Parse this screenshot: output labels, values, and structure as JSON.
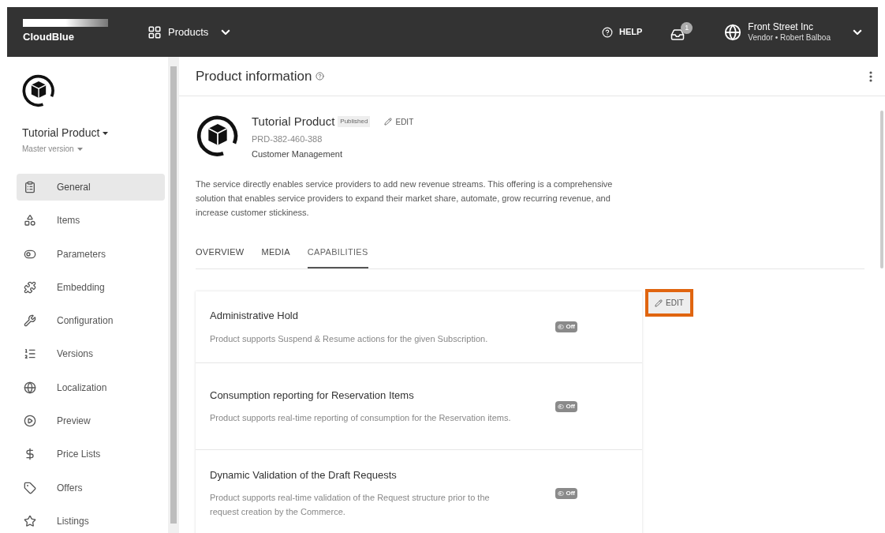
{
  "topbar": {
    "logo": "CloudBlue",
    "module": "Products",
    "help": "HELP",
    "notifications": "1",
    "account": {
      "name": "Front Street Inc",
      "role": "Vendor • Robert Balboa"
    }
  },
  "sidebar": {
    "product": "Tutorial Product",
    "version": "Master version",
    "items": [
      {
        "label": "General",
        "selected": true
      },
      {
        "label": "Items",
        "selected": false
      },
      {
        "label": "Parameters",
        "selected": false
      },
      {
        "label": "Embedding",
        "selected": false
      },
      {
        "label": "Configuration",
        "selected": false
      },
      {
        "label": "Versions",
        "selected": false
      },
      {
        "label": "Localization",
        "selected": false
      },
      {
        "label": "Preview",
        "selected": false
      },
      {
        "label": "Price Lists",
        "selected": false
      },
      {
        "label": "Offers",
        "selected": false
      },
      {
        "label": "Listings",
        "selected": false
      }
    ]
  },
  "page": {
    "title": "Product information",
    "product": {
      "name": "Tutorial Product",
      "status": "Published",
      "edit": "EDIT",
      "id": "PRD-382-460-388",
      "category": "Customer Management",
      "description": "The service directly enables service providers to add new revenue streams. This offering is a comprehensive solution that enables service providers to expand their market share, automate, grow recurring revenue, and increase customer stickiness."
    },
    "tabs": [
      {
        "label": "OVERVIEW",
        "selected": false
      },
      {
        "label": "MEDIA",
        "selected": false
      },
      {
        "label": "CAPABILITIES",
        "selected": true
      }
    ],
    "capabilities": [
      {
        "title": "Administrative Hold",
        "description": "Product supports Suspend & Resume actions for the given Subscription.",
        "on": false,
        "status": "Off"
      },
      {
        "title": "Consumption reporting for Reservation Items",
        "description": "Product supports real-time reporting of consumption for the Reservation items.",
        "on": false,
        "status": "Off"
      },
      {
        "title": "Dynamic Validation of the Draft Requests",
        "description": "Product supports real-time validation of the Request structure prior to the request creation by the Commerce.",
        "on": false,
        "status": "Off"
      }
    ],
    "edit_button": {
      "label": "EDIT",
      "highlighted": true
    }
  }
}
